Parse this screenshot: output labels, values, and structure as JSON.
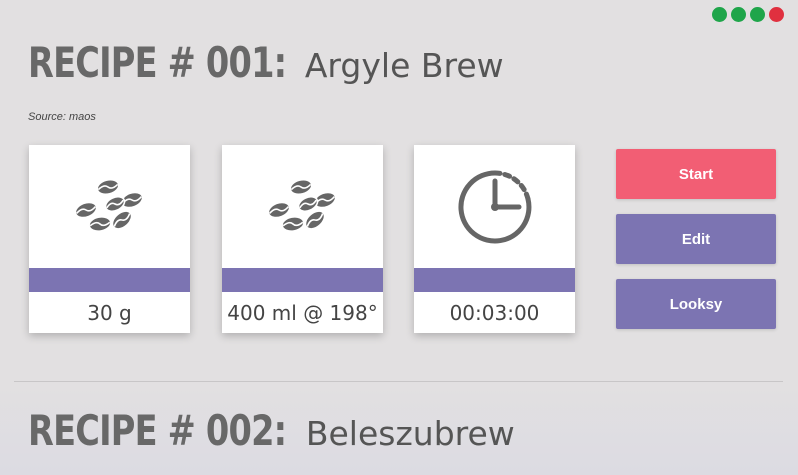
{
  "window": {
    "dot_colors": [
      "#1fa54a",
      "#1fa54a",
      "#1fa54a",
      "#e0303f"
    ]
  },
  "colors": {
    "accent_purple": "#7c74b2",
    "start_red": "#f25e74",
    "icon_gray": "#666666"
  },
  "recipes": [
    {
      "number_label": "RECIPE # 001:",
      "name": "Argyle Brew",
      "source": "Source: maos",
      "cards": [
        {
          "icon": "coffee-beans-icon",
          "value": "30 g"
        },
        {
          "icon": "coffee-beans-icon",
          "value": "400 ml @ 198°"
        },
        {
          "icon": "timer-icon",
          "value": "00:03:00"
        }
      ],
      "actions": {
        "start": "Start",
        "edit": "Edit",
        "looksy": "Looksy"
      }
    },
    {
      "number_label": "RECIPE # 002:",
      "name": "Beleszubrew"
    }
  ]
}
